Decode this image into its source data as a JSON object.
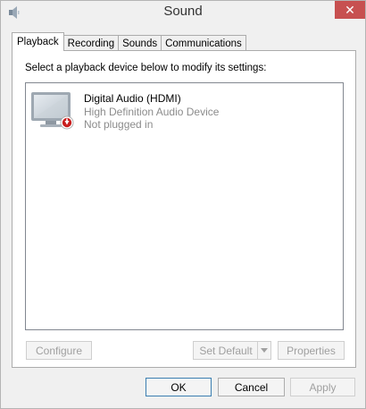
{
  "window": {
    "title": "Sound",
    "close_glyph": "✕"
  },
  "tabs": [
    {
      "label": "Playback",
      "active": true
    },
    {
      "label": "Recording",
      "active": false
    },
    {
      "label": "Sounds",
      "active": false
    },
    {
      "label": "Communications",
      "active": false
    }
  ],
  "panel": {
    "instruction": "Select a playback device below to modify its settings:",
    "devices": [
      {
        "name": "Digital Audio (HDMI)",
        "description": "High Definition Audio Device",
        "status": "Not plugged in",
        "icon": "hdmi-monitor-icon"
      }
    ],
    "configure_label": "Configure",
    "set_default_label": "Set Default",
    "properties_label": "Properties"
  },
  "footer": {
    "ok_label": "OK",
    "cancel_label": "Cancel",
    "apply_label": "Apply"
  },
  "colors": {
    "close_button": "#c75050",
    "disabled_text": "#a0a0a0",
    "secondary_text": "#8c8c8c",
    "status_badge": "#c81e1e"
  }
}
